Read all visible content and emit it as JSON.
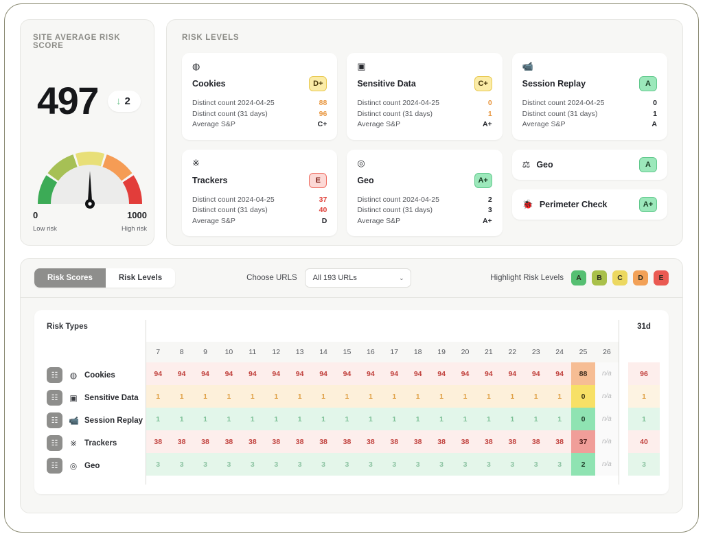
{
  "score_panel": {
    "title": "SITE AVERAGE RISK SCORE",
    "score": "497",
    "delta_arrow": "↓",
    "delta_value": "2",
    "gauge_min": "0",
    "gauge_max": "1000",
    "gauge_min_label": "Low risk",
    "gauge_max_label": "High risk",
    "gauge_value": 497,
    "gauge_range": [
      0,
      1000
    ],
    "segment_colors": [
      "#3cab56",
      "#a6c055",
      "#e8df78",
      "#f59c55",
      "#e23d3a"
    ]
  },
  "risk_levels": {
    "title": "RISK LEVELS",
    "labels": {
      "distinct_day": "Distinct count 2024-04-25",
      "distinct_31": "Distinct count (31 days)",
      "avg_sp": "Average S&P"
    },
    "cards": [
      {
        "name": "Cookies",
        "icon": "cookie-icon",
        "glyph": "◍",
        "grade": "D+",
        "grade_class": "g-Dp",
        "distinct_day": "88",
        "distinct_31": "96",
        "avg_sp": "C+",
        "val_class": "v-orange",
        "sp_class": "v-dark"
      },
      {
        "name": "Sensitive Data",
        "icon": "id-card-icon",
        "glyph": "▣",
        "grade": "C+",
        "grade_class": "g-Cp",
        "distinct_day": "0",
        "distinct_31": "1",
        "avg_sp": "A+",
        "val_class": "v-orange",
        "sp_class": "v-dark"
      },
      {
        "name": "Session Replay",
        "icon": "cctv-camera-icon",
        "glyph": "📹",
        "grade": "A",
        "grade_class": "g-A",
        "distinct_day": "0",
        "distinct_31": "1",
        "avg_sp": "A",
        "val_class": "v-dark",
        "sp_class": "v-dark"
      },
      {
        "name": "Trackers",
        "icon": "tracker-icon",
        "glyph": "※",
        "grade": "E",
        "grade_class": "g-E",
        "distinct_day": "37",
        "distinct_31": "40",
        "avg_sp": "D",
        "val_class": "v-red",
        "sp_class": "v-dark"
      },
      {
        "name": "Geo",
        "icon": "globe-icon",
        "glyph": "◎",
        "grade": "A+",
        "grade_class": "g-Ap",
        "distinct_day": "2",
        "distinct_31": "3",
        "avg_sp": "A+",
        "val_class": "v-dark",
        "sp_class": "v-dark"
      }
    ],
    "mini_cards": [
      {
        "name": "Geo",
        "icon": "scales-icon",
        "glyph": "⚖",
        "grade": "A",
        "grade_class": "g-A"
      },
      {
        "name": "Perimeter Check",
        "icon": "bug-icon",
        "glyph": "🐞",
        "grade": "A+",
        "grade_class": "g-Ap"
      }
    ]
  },
  "toolbar": {
    "tabs": [
      {
        "label": "Risk Scores",
        "active": true
      },
      {
        "label": "Risk Levels",
        "active": false
      }
    ],
    "choose_urls_label": "Choose URLS",
    "url_value": "All 193 URLs",
    "chevron": "⌄",
    "highlight_label": "Highlight Risk Levels",
    "highlight_badges": [
      {
        "label": "A",
        "color": "#56bf72"
      },
      {
        "label": "B",
        "color": "#a9c04a"
      },
      {
        "label": "C",
        "color": "#ecd860"
      },
      {
        "label": "D",
        "color": "#f2a157"
      },
      {
        "label": "E",
        "color": "#ea5a52"
      }
    ]
  },
  "chart_data": {
    "type": "heatmap",
    "title": "Risk Types",
    "summary_column_label": "31d",
    "categories": [
      "7",
      "8",
      "9",
      "10",
      "11",
      "12",
      "13",
      "14",
      "15",
      "16",
      "17",
      "18",
      "19",
      "20",
      "21",
      "22",
      "23",
      "24",
      "25",
      "26"
    ],
    "row_icons": [
      "cookie-icon",
      "id-card-icon",
      "cctv-camera-icon",
      "tracker-icon",
      "globe-icon"
    ],
    "row_glyphs": [
      "◍",
      "▣",
      "📹",
      "※",
      "◎"
    ],
    "rows": [
      {
        "name": "Cookies",
        "values": [
          "94",
          "94",
          "94",
          "94",
          "94",
          "94",
          "94",
          "94",
          "94",
          "94",
          "94",
          "94",
          "94",
          "94",
          "94",
          "94",
          "94",
          "94",
          "88",
          "n/a"
        ],
        "summary": "96",
        "base_bg": "#fdeeec",
        "base_fg": "#c0403c",
        "highlight_index": 18,
        "highlight_bg": "#f6bd94",
        "highlight_fg": "#3a2a1c",
        "summary_bg": "#fdeeec",
        "summary_fg": "#c0403c"
      },
      {
        "name": "Sensitive Data",
        "values": [
          "1",
          "1",
          "1",
          "1",
          "1",
          "1",
          "1",
          "1",
          "1",
          "1",
          "1",
          "1",
          "1",
          "1",
          "1",
          "1",
          "1",
          "1",
          "0",
          "n/a"
        ],
        "summary": "1",
        "base_bg": "#fdf0da",
        "base_fg": "#dfa046",
        "highlight_index": 18,
        "highlight_bg": "#f7e066",
        "highlight_fg": "#3a3414",
        "summary_bg": "#fdf3e2",
        "summary_fg": "#dfa046"
      },
      {
        "name": "Session Replay",
        "values": [
          "1",
          "1",
          "1",
          "1",
          "1",
          "1",
          "1",
          "1",
          "1",
          "1",
          "1",
          "1",
          "1",
          "1",
          "1",
          "1",
          "1",
          "1",
          "0",
          "n/a"
        ],
        "summary": "1",
        "base_bg": "#e2f6ea",
        "base_fg": "#7bbf95",
        "highlight_index": 18,
        "highlight_bg": "#8fe3b2",
        "highlight_fg": "#1d3a27",
        "summary_bg": "#e2f6ea",
        "summary_fg": "#7bbf95"
      },
      {
        "name": "Trackers",
        "values": [
          "38",
          "38",
          "38",
          "38",
          "38",
          "38",
          "38",
          "38",
          "38",
          "38",
          "38",
          "38",
          "38",
          "38",
          "38",
          "38",
          "38",
          "38",
          "37",
          "n/a"
        ],
        "summary": "40",
        "base_bg": "#fdeeec",
        "base_fg": "#c0403c",
        "highlight_index": 18,
        "highlight_bg": "#f09e99",
        "highlight_fg": "#4a1a17",
        "summary_bg": "#fdeeec",
        "summary_fg": "#c0403c"
      },
      {
        "name": "Geo",
        "values": [
          "3",
          "3",
          "3",
          "3",
          "3",
          "3",
          "3",
          "3",
          "3",
          "3",
          "3",
          "3",
          "3",
          "3",
          "3",
          "3",
          "3",
          "3",
          "2",
          "n/a"
        ],
        "summary": "3",
        "base_bg": "#e4f6ea",
        "base_fg": "#8cc3a2",
        "highlight_index": 18,
        "highlight_bg": "#8fe3b2",
        "highlight_fg": "#1d3a27",
        "summary_bg": "#e4f6ea",
        "summary_fg": "#8cc3a2"
      }
    ]
  }
}
